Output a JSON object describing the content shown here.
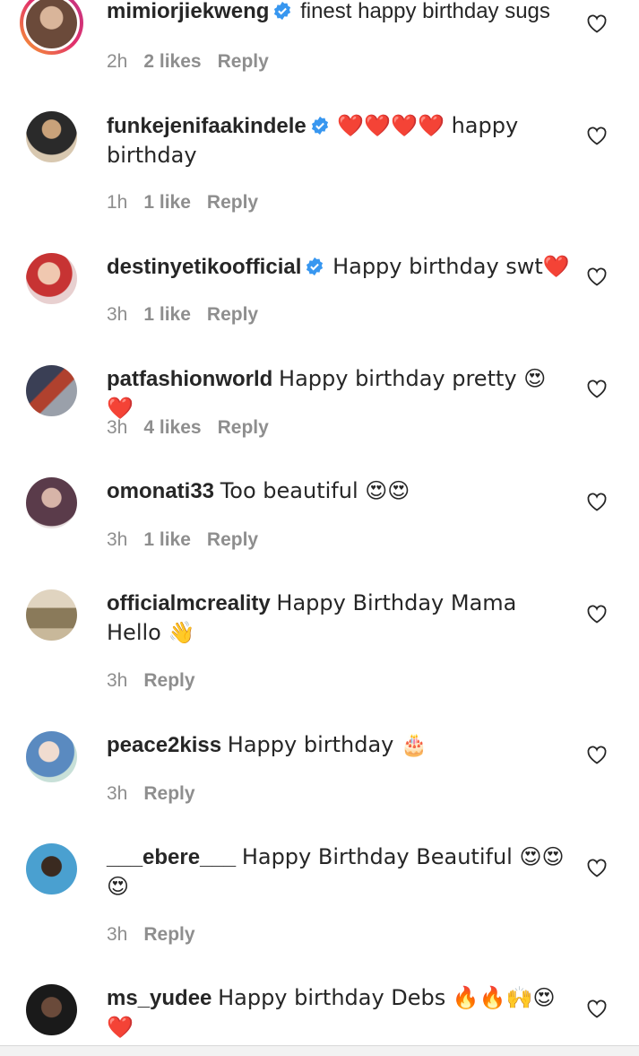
{
  "comments": [
    {
      "username": "mimiorjiekweng",
      "verified": true,
      "text": "finest happy birthday sugs",
      "time": "2h",
      "likes": "2 likes",
      "reply": "Reply",
      "avatar_colors": [
        "#6b4a3a",
        "#d9b59a"
      ]
    },
    {
      "username": "funkejenifaakindele",
      "verified": true,
      "text": "❤️❤️❤️❤️ happy birthday",
      "time": "1h",
      "likes": "1 like",
      "reply": "Reply",
      "avatar_colors": [
        "#2a2a2a",
        "#c9a27a"
      ]
    },
    {
      "username": "destinyetikoofficial",
      "verified": true,
      "text": "Happy birthday swt❤️",
      "time": "3h",
      "likes": "1 like",
      "reply": "Reply",
      "avatar_colors": [
        "#c73333",
        "#f0c8b0"
      ]
    },
    {
      "username": "patfashionworld",
      "verified": false,
      "text": "Happy birthday pretty 😍❤️",
      "time": "3h",
      "likes": "4 likes",
      "reply": "Reply",
      "avatar_colors": [
        "#3a3f55",
        "#b0412e"
      ]
    },
    {
      "username": "omonati33",
      "verified": false,
      "text": "Too beautiful 😍😍",
      "time": "3h",
      "likes": "1 like",
      "reply": "Reply",
      "avatar_colors": [
        "#5a3b4a",
        "#d7b4a8"
      ]
    },
    {
      "username": "officialmcreality",
      "verified": false,
      "text": "Happy Birthday Mama Hello 👋",
      "time": "3h",
      "likes": "",
      "reply": "Reply",
      "avatar_colors": [
        "#8a7a5a",
        "#e0d4c0"
      ]
    },
    {
      "username": "peace2kiss",
      "verified": false,
      "text": "Happy birthday 🎂",
      "time": "3h",
      "likes": "",
      "reply": "Reply",
      "avatar_colors": [
        "#5a8ac0",
        "#f0dcd0"
      ]
    },
    {
      "username": "___ebere___",
      "verified": false,
      "text": "Happy Birthday Beautiful 😍😍😍",
      "time": "3h",
      "likes": "",
      "reply": "Reply",
      "avatar_colors": [
        "#4aa0d0",
        "#3a2a20"
      ]
    },
    {
      "username": "ms_yudee",
      "verified": false,
      "text": "Happy birthday Debs 🔥🔥🙌😍❤️",
      "time": "",
      "likes": "",
      "reply": "",
      "avatar_colors": [
        "#1a1a1a",
        "#6a4a3a"
      ]
    }
  ],
  "colors": {
    "verified_blue": "#3897f0",
    "meta_gray": "#8e8e8e",
    "text": "#262626"
  },
  "icons": {
    "like": "heart-outline-icon",
    "verified": "verified-badge-icon"
  }
}
